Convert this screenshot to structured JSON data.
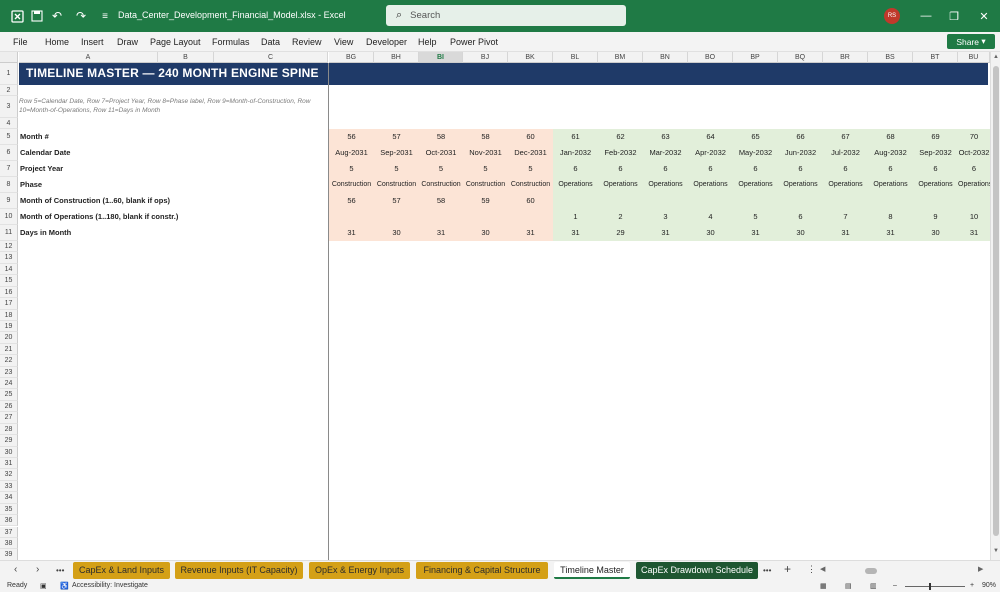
{
  "titlebar": {
    "filename": "Data_Center_Development_Financial_Model.xlsx  -  Excel",
    "search_placeholder": "Search",
    "avatar": "RS",
    "icons": [
      "excel-logo-icon",
      "save-icon",
      "undo-icon",
      "redo-icon",
      "customize-icon"
    ]
  },
  "menu": [
    "File",
    "Home",
    "Insert",
    "Draw",
    "Page Layout",
    "Formulas",
    "Data",
    "Review",
    "View",
    "Developer",
    "Help",
    "Power Pivot"
  ],
  "share_label": "Share",
  "columns": [
    "A",
    "B",
    "C",
    "BG",
    "BH",
    "BI",
    "BJ",
    "BK",
    "BL",
    "BM",
    "BN",
    "BO",
    "BP",
    "BQ",
    "BR",
    "BS",
    "BT",
    "BU"
  ],
  "selected_column": "BI",
  "row_numbers": [
    "1",
    "2",
    "3",
    "4",
    "5",
    "6",
    "7",
    "8",
    "9",
    "10",
    "11",
    "12",
    "13",
    "14",
    "15",
    "16",
    "17",
    "18",
    "19",
    "20",
    "21",
    "22",
    "23",
    "24",
    "25",
    "26",
    "27",
    "28",
    "29",
    "30",
    "31",
    "32",
    "33",
    "34",
    "35",
    "36",
    "37",
    "38",
    "39"
  ],
  "banner_title": "TIMELINE MASTER — 240 MONTH ENGINE SPINE",
  "note": "Row 5=Calendar Date, Row 7=Project Year, Row 8=Phase label, Row 9=Month-of-Construction, Row 10=Month-of-Operations, Row 11=Days in Month",
  "labels": {
    "r5": "Month #",
    "r6": "Calendar Date",
    "r7": "Project Year",
    "r8": "Phase",
    "r9": "Month of Construction (1..60, blank if ops)",
    "r10": "Month of Operations (1..180, blank if constr.)",
    "r11": "Days in Month"
  },
  "grid": {
    "r5": [
      "56",
      "57",
      "58",
      "58",
      "60",
      "61",
      "62",
      "63",
      "64",
      "65",
      "66",
      "67",
      "68",
      "69",
      "70"
    ],
    "r6": [
      "Aug-2031",
      "Sep-2031",
      "Oct-2031",
      "Nov-2031",
      "Dec-2031",
      "Jan-2032",
      "Feb-2032",
      "Mar-2032",
      "Apr-2032",
      "May-2032",
      "Jun-2032",
      "Jul-2032",
      "Aug-2032",
      "Sep-2032",
      "Oct-2032"
    ],
    "r7": [
      "5",
      "5",
      "5",
      "5",
      "5",
      "6",
      "6",
      "6",
      "6",
      "6",
      "6",
      "6",
      "6",
      "6",
      "6"
    ],
    "r8": [
      "Construction",
      "Construction",
      "Construction",
      "Construction",
      "Construction",
      "Operations",
      "Operations",
      "Operations",
      "Operations",
      "Operations",
      "Operations",
      "Operations",
      "Operations",
      "Operations",
      "Operations"
    ],
    "r9": [
      "56",
      "57",
      "58",
      "59",
      "60",
      "",
      "",
      "",
      "",
      "",
      "",
      "",
      "",
      "",
      ""
    ],
    "r10": [
      "",
      "",
      "",
      "",
      "",
      "1",
      "2",
      "3",
      "4",
      "5",
      "6",
      "7",
      "8",
      "9",
      "10"
    ],
    "r11": [
      "31",
      "30",
      "31",
      "30",
      "31",
      "31",
      "29",
      "31",
      "30",
      "31",
      "30",
      "31",
      "31",
      "30",
      "31"
    ]
  },
  "colors": {
    "construction_fill": "#fce4d6",
    "operations_fill": "#e2efda",
    "banner": "#1f3a68",
    "ribbon": "#1f7a45",
    "tab_gold": "#d4a017",
    "tab_dark": "#1e5631"
  },
  "tabs": [
    {
      "label": "CapEx & Land Inputs",
      "style": "gold"
    },
    {
      "label": "Revenue Inputs (IT Capacity)",
      "style": "gold"
    },
    {
      "label": "OpEx & Energy Inputs",
      "style": "gold"
    },
    {
      "label": "Financing & Capital Structure",
      "style": "gold"
    },
    {
      "label": "Timeline Master",
      "style": "active"
    },
    {
      "label": "CapEx Drawdown Schedule",
      "style": "dark"
    }
  ],
  "status": {
    "ready": "Ready",
    "accessibility": "Accessibility: Investigate",
    "zoom": "90%"
  }
}
